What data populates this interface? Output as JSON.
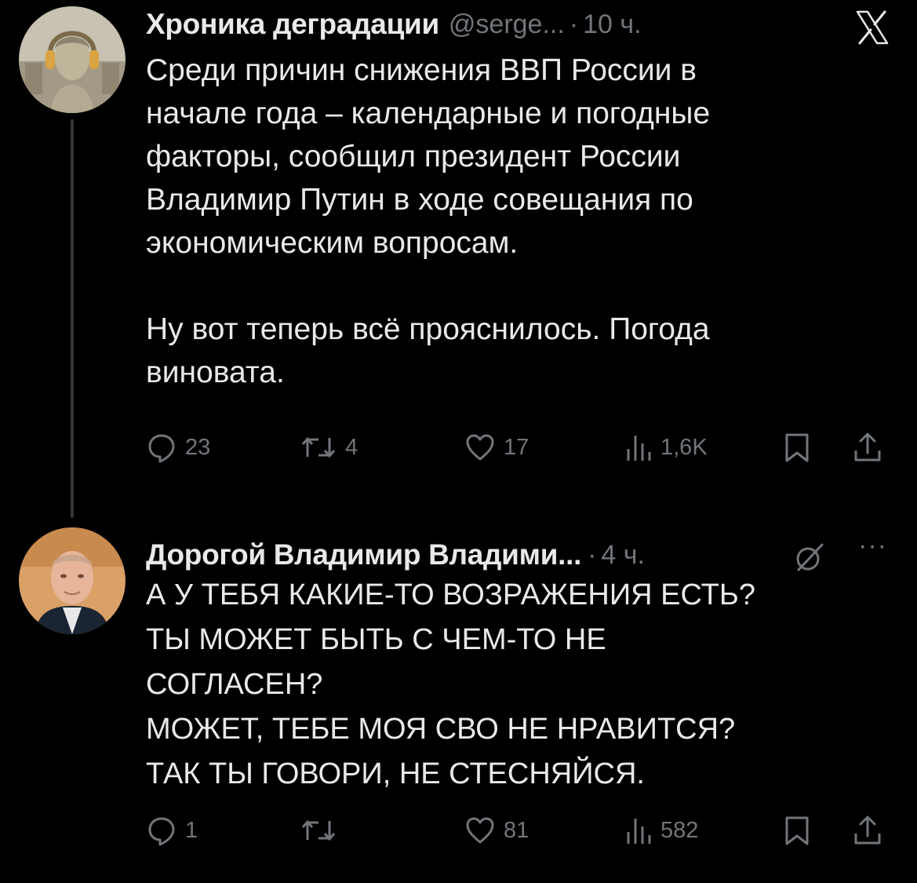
{
  "thread": [
    {
      "author": {
        "name": "Хроника деградации",
        "handle": "@serge...",
        "time": "10 ч."
      },
      "text": "Среди причин снижения ВВП России в\nначале года – календарные и погодные\nфакторы, сообщил президент России\nВладимир Путин в ходе совещания по\nэкономическим вопросам.\n\nНу вот теперь всё прояснилось. Погода\nвиновата.",
      "stats": {
        "replies": "23",
        "reposts": "4",
        "likes": "17",
        "views": "1,6K"
      }
    },
    {
      "author": {
        "name": "Дорогой Владимир Владими...",
        "time": "4 ч."
      },
      "text": "А У ТЕБЯ КАКИЕ-ТО ВОЗРАЖЕНИЯ ЕСТЬ?\nТЫ МОЖЕТ БЫТЬ С ЧЕМ-ТО НЕ\nСОГЛАСЕН?\nМОЖЕТ, ТЕБЕ МОЯ СВО НЕ НРАВИТСЯ?\nТАК ТЫ ГОВОРИ, НЕ СТЕСНЯЙСЯ.",
      "stats": {
        "replies": "1",
        "reposts": "",
        "likes": "81",
        "views": "582"
      }
    }
  ],
  "icons": {
    "top_right": "x-logo-icon",
    "reply": "reply-icon",
    "repost": "repost-icon",
    "like": "heart-icon",
    "views": "views-icon",
    "bookmark": "bookmark-icon",
    "share": "share-icon",
    "grok": "grok-icon",
    "more": "more-icon"
  },
  "colors": {
    "background": "#000000",
    "text": "#e7e9ea",
    "muted": "#71767b"
  }
}
